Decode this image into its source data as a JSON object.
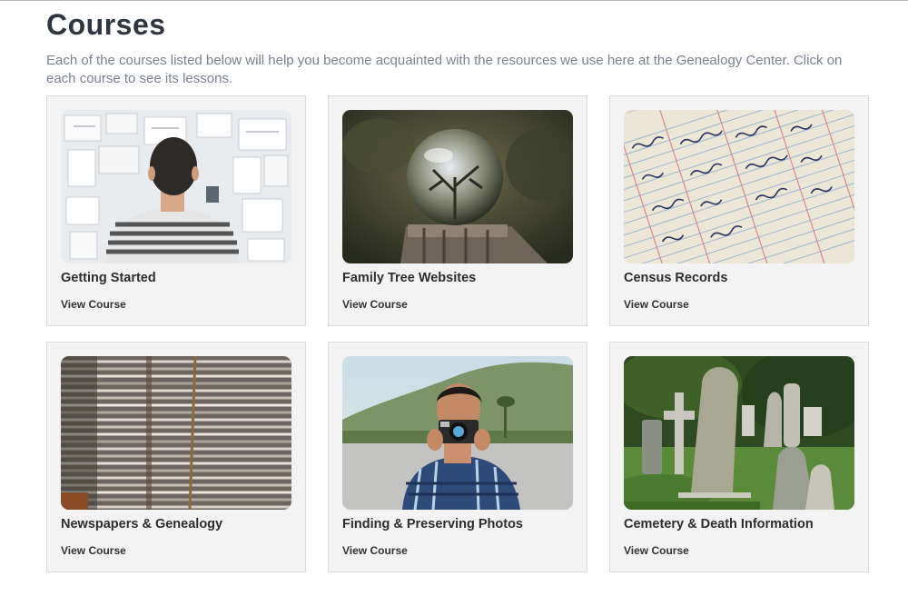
{
  "page": {
    "title": "Courses",
    "intro": "Each of the courses listed below will help you become acquainted with the resources we use here at the Genealogy Center. Click on each course to see its lessons."
  },
  "courses": [
    {
      "title": "Getting Started",
      "link": "View Course",
      "image": "person-viewing-wall-of-notes-photo"
    },
    {
      "title": "Family Tree Websites",
      "link": "View Course",
      "image": "crystal-ball-on-stump-photo"
    },
    {
      "title": "Census Records",
      "link": "View Course",
      "image": "handwritten-ledger-photo"
    },
    {
      "title": "Newspapers & Genealogy",
      "link": "View Course",
      "image": "stacked-newspapers-photo"
    },
    {
      "title": "Finding & Preserving Photos",
      "link": "View Course",
      "image": "photographer-with-camera-photo"
    },
    {
      "title": "Cemetery & Death Information",
      "link": "View Course",
      "image": "old-gravestones-photo"
    }
  ]
}
